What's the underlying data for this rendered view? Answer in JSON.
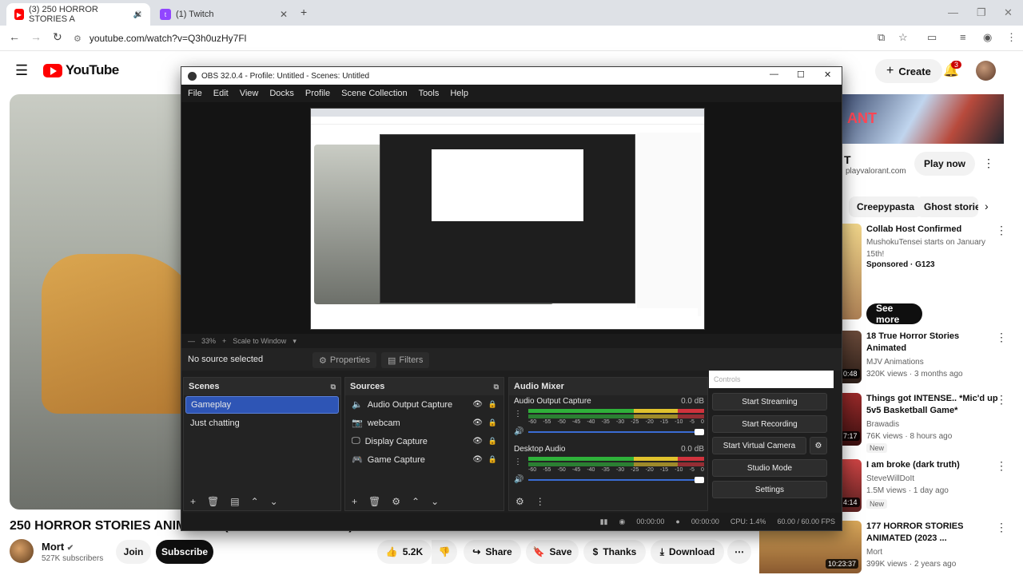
{
  "browser": {
    "tabs": [
      {
        "title": "(3) 250 HORROR STORIES A",
        "active": true,
        "favicon_color": "#ff0000"
      },
      {
        "title": "(1) Twitch",
        "active": false,
        "favicon_color": "#9146ff"
      }
    ],
    "url": "youtube.com/watch?v=Q3h0uzHy7Fl"
  },
  "youtube": {
    "logo_text": "YouTube",
    "create_label": "Create",
    "notification_count": "3",
    "video_title": "250 HORROR STORIES ANIMATED (2024 COMPILATION)",
    "channel": {
      "name": "Mort",
      "subscribers": "527K subscribers",
      "join_label": "Join",
      "subscribe_label": "Subscribe"
    },
    "actions": {
      "likes": "5.2K",
      "share": "Share",
      "save": "Save",
      "thanks": "Thanks",
      "download": "Download"
    },
    "ad": {
      "banner_text": "ANT",
      "headline": "T",
      "domain": "playvalorant.com",
      "cta": "Play now"
    },
    "chips": [
      "Creepypasta",
      "Ghost storie"
    ],
    "recommendations": [
      {
        "title": "Collab Host Confirmed",
        "line1": "MushokuTensei starts on January 15th!",
        "line2": "Sponsored · G123",
        "cta": "See more",
        "duration": ""
      },
      {
        "title": "18 True Horror Stories Animated",
        "line1": "MJV Animations",
        "line2": "320K views · 3 months ago",
        "duration": "0:48"
      },
      {
        "title": "Things got INTENSE.. *Mic'd up 5v5 Basketball Game*",
        "line1": "Brawadis",
        "line2": "76K views · 8 hours ago",
        "badge": "New",
        "duration": "7:17"
      },
      {
        "title": "I am broke (dark truth)",
        "line1": "SteveWillDoIt",
        "line2": "1.5M views · 1 day ago",
        "badge": "New",
        "duration": "4:14"
      },
      {
        "title": "177 HORROR STORIES ANIMATED (2023 ...",
        "line1": "Mort",
        "line2": "399K views · 2 years ago",
        "duration": "10:23:37"
      }
    ]
  },
  "obs": {
    "title": "OBS 32.0.4 - Profile: Untitled - Scenes: Untitled",
    "menu": [
      "File",
      "Edit",
      "View",
      "Docks",
      "Profile",
      "Scene Collection",
      "Tools",
      "Help"
    ],
    "zoom": "33%",
    "scale_mode": "Scale to Window",
    "no_source": "No source selected",
    "properties": "Properties",
    "filters": "Filters",
    "scenes_title": "Scenes",
    "scenes": [
      "Gameplay",
      "Just chatting"
    ],
    "sources_title": "Sources",
    "sources": [
      "Audio Output Capture",
      "webcam",
      "Display Capture",
      "Game Capture"
    ],
    "mixer_title": "Audio Mixer",
    "mixer": [
      {
        "name": "Audio Output Capture",
        "db": "0.0 dB"
      },
      {
        "name": "Desktop Audio",
        "db": "0.0 dB"
      }
    ],
    "meter_ticks": [
      "-60",
      "-55",
      "-50",
      "-45",
      "-40",
      "-35",
      "-30",
      "-25",
      "-20",
      "-15",
      "-10",
      "-5",
      "0"
    ],
    "controls_title": "Controls",
    "controls": [
      "Start Streaming",
      "Start Recording",
      "Start Virtual Camera",
      "Studio Mode",
      "Settings"
    ],
    "status": {
      "rec_time": "00:00:00",
      "stream_time": "00:00:00",
      "cpu": "CPU: 1.4%",
      "fps": "60.00 / 60.00 FPS"
    }
  }
}
